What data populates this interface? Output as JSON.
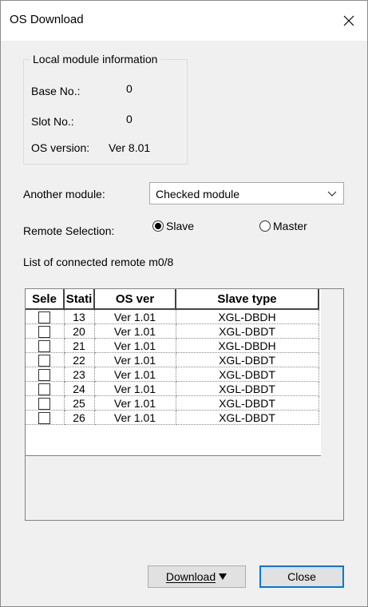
{
  "window": {
    "title": "OS Download"
  },
  "local_module": {
    "group_title": "Local module information",
    "base_label": "Base No.:",
    "base_value": "0",
    "slot_label": "Slot No.:",
    "slot_value": "0",
    "os_label": "OS version:",
    "os_value": "Ver 8.01"
  },
  "another_module": {
    "label": "Another module:",
    "selected": "Checked module"
  },
  "remote_selection": {
    "label": "Remote Selection:",
    "options": [
      "Slave",
      "Master"
    ],
    "selected": "Slave"
  },
  "list": {
    "caption": "List of connected remote m0/8",
    "columns": [
      "Sele",
      "Stati",
      "OS ver",
      "Slave type"
    ],
    "rows": [
      {
        "station": "13",
        "os_ver": "Ver 1.01",
        "slave_type": "XGL-DBDH"
      },
      {
        "station": "20",
        "os_ver": "Ver 1.01",
        "slave_type": "XGL-DBDT"
      },
      {
        "station": "21",
        "os_ver": "Ver 1.01",
        "slave_type": "XGL-DBDH"
      },
      {
        "station": "22",
        "os_ver": "Ver 1.01",
        "slave_type": "XGL-DBDT"
      },
      {
        "station": "23",
        "os_ver": "Ver 1.01",
        "slave_type": "XGL-DBDT"
      },
      {
        "station": "24",
        "os_ver": "Ver 1.01",
        "slave_type": "XGL-DBDT"
      },
      {
        "station": "25",
        "os_ver": "Ver 1.01",
        "slave_type": "XGL-DBDT"
      },
      {
        "station": "26",
        "os_ver": "Ver 1.01",
        "slave_type": "XGL-DBDT"
      }
    ]
  },
  "buttons": {
    "download": "Download",
    "close": "Close"
  },
  "colors": {
    "dialog_bg": "#f0f0f0",
    "focus_border": "#0078d7"
  },
  "icons": {
    "close": "close-icon",
    "dropdown": "chevron-down-icon",
    "download_menu": "triangle-down-icon"
  }
}
